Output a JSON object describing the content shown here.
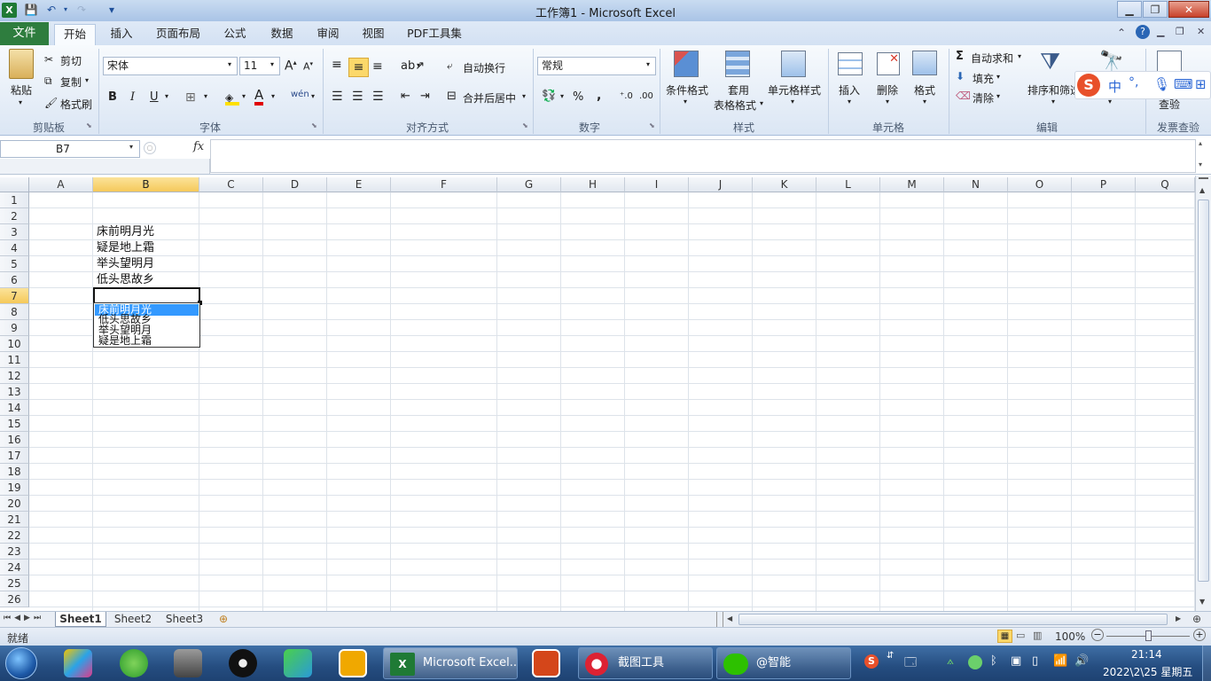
{
  "window": {
    "title": "工作簿1 - Microsoft Excel"
  },
  "quick_access": {
    "save": "save-icon",
    "undo": "undo-icon",
    "redo": "redo-icon",
    "customize": "▾"
  },
  "ribbon_tabs": [
    "文件",
    "开始",
    "插入",
    "页面布局",
    "公式",
    "数据",
    "审阅",
    "视图",
    "PDF工具集"
  ],
  "clipboard": {
    "paste": "粘贴",
    "cut": "剪切",
    "copy": "复制",
    "format_painter": "格式刷",
    "label": "剪贴板"
  },
  "font": {
    "name": "宋体",
    "size": "11",
    "label": "字体",
    "bold": "B",
    "italic": "I",
    "underline": "U",
    "wen": "wén",
    "A": "A"
  },
  "alignment": {
    "wrap": "自动换行",
    "merge": "合并后居中",
    "label": "对齐方式"
  },
  "number": {
    "format": "常规",
    "percent": "%",
    "comma": ",",
    "label": "数字"
  },
  "styles": {
    "conditional": "条件格式",
    "table_line1": "套用",
    "table_line2": "表格格式",
    "cell_styles": "单元格样式",
    "label": "样式"
  },
  "cells": {
    "insert": "插入",
    "delete": "删除",
    "format": "格式",
    "label": "单元格"
  },
  "editing": {
    "autosum": "自动求和",
    "fill": "填充",
    "clear": "清除",
    "sort": "排序和筛选",
    "sigma": "Σ",
    "label": "编辑"
  },
  "invoice": {
    "check": "查验",
    "label": "发票查验"
  },
  "ime": {
    "mode": "中",
    "punct": "°,"
  },
  "formula_bar": {
    "name_box": "B7",
    "fx": "fx",
    "formula": ""
  },
  "columns": [
    "A",
    "B",
    "C",
    "D",
    "E",
    "F",
    "G",
    "H",
    "I",
    "J",
    "K",
    "L",
    "M",
    "N",
    "O",
    "P",
    "Q"
  ],
  "selected_column": "B",
  "rows": [
    "1",
    "2",
    "3",
    "4",
    "5",
    "6",
    "7",
    "8",
    "9",
    "10",
    "11",
    "12",
    "13",
    "14",
    "15",
    "16",
    "17",
    "18",
    "19",
    "20",
    "21",
    "22",
    "23",
    "24",
    "25",
    "26"
  ],
  "selected_row": "7",
  "cells_data": {
    "B3": "床前明月光",
    "B4": "疑是地上霜",
    "B5": "举头望明月",
    "B6": "低头思故乡"
  },
  "dropdown": {
    "items": [
      "床前明月光",
      "低头思故乡",
      "举头望明月",
      "疑是地上霜"
    ],
    "selected_index": 0
  },
  "sheets": [
    "Sheet1",
    "Sheet2",
    "Sheet3"
  ],
  "active_sheet": "Sheet1",
  "status": {
    "ready": "就绪",
    "zoom": "100%",
    "minus": "−",
    "plus": "+"
  },
  "taskbar": {
    "buttons": [
      "Microsoft Excel...",
      "截图工具",
      "@智能"
    ],
    "time": "21:14",
    "date": "2022\\2\\25 星期五"
  },
  "colors": {
    "accent": "#2e7d3e",
    "selection": "#3399ff",
    "header_sel": "#f5c95a",
    "taskbar": "#254d80"
  }
}
